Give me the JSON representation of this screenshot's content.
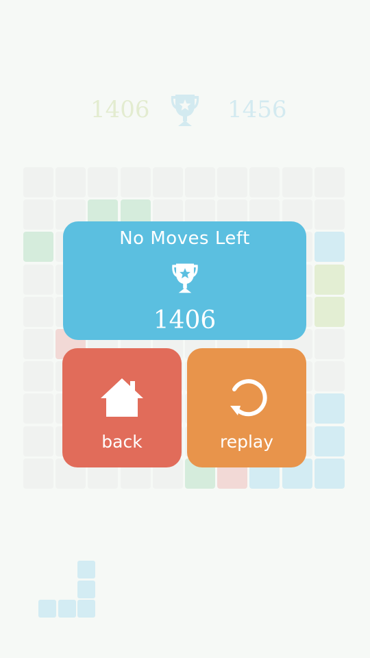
{
  "hud": {
    "current_score": "1406",
    "best_score": "1456",
    "trophy_icon": "trophy-icon"
  },
  "colors": {
    "background": "#f6f9f6",
    "empty_cell": "#f0f2f0",
    "green_tile": "#d5ecdc",
    "lime_tile": "#e3eed3",
    "blue_tile": "#d3ecf3",
    "red_tile": "#f2d9d6",
    "panel_blue": "#5bbfe0",
    "back_red": "#e16c5a",
    "replay_orange": "#e8944b"
  },
  "result": {
    "title": "No Moves Left",
    "score": "1406",
    "icon": "trophy-icon"
  },
  "buttons": {
    "back_label": "back",
    "back_icon": "home-icon",
    "replay_label": "replay",
    "replay_icon": "replay-icon"
  },
  "board": {
    "size": 10,
    "tiles": [
      {
        "row": 1,
        "col": 2,
        "color": "green"
      },
      {
        "row": 1,
        "col": 3,
        "color": "green"
      },
      {
        "row": 2,
        "col": 0,
        "color": "green"
      },
      {
        "row": 2,
        "col": 9,
        "color": "blue"
      },
      {
        "row": 3,
        "col": 9,
        "color": "lime"
      },
      {
        "row": 4,
        "col": 9,
        "color": "lime"
      },
      {
        "row": 5,
        "col": 1,
        "color": "red"
      },
      {
        "row": 7,
        "col": 9,
        "color": "blue"
      },
      {
        "row": 8,
        "col": 9,
        "color": "blue"
      },
      {
        "row": 9,
        "col": 5,
        "color": "green"
      },
      {
        "row": 9,
        "col": 6,
        "color": "red"
      },
      {
        "row": 9,
        "col": 7,
        "color": "blue"
      },
      {
        "row": 9,
        "col": 8,
        "color": "blue"
      },
      {
        "row": 9,
        "col": 9,
        "color": "blue"
      }
    ]
  },
  "next_piece": {
    "color": "blue",
    "cells": [
      {
        "row": 0,
        "col": 2
      },
      {
        "row": 1,
        "col": 2
      },
      {
        "row": 2,
        "col": 0
      },
      {
        "row": 2,
        "col": 1
      },
      {
        "row": 2,
        "col": 2
      }
    ]
  }
}
